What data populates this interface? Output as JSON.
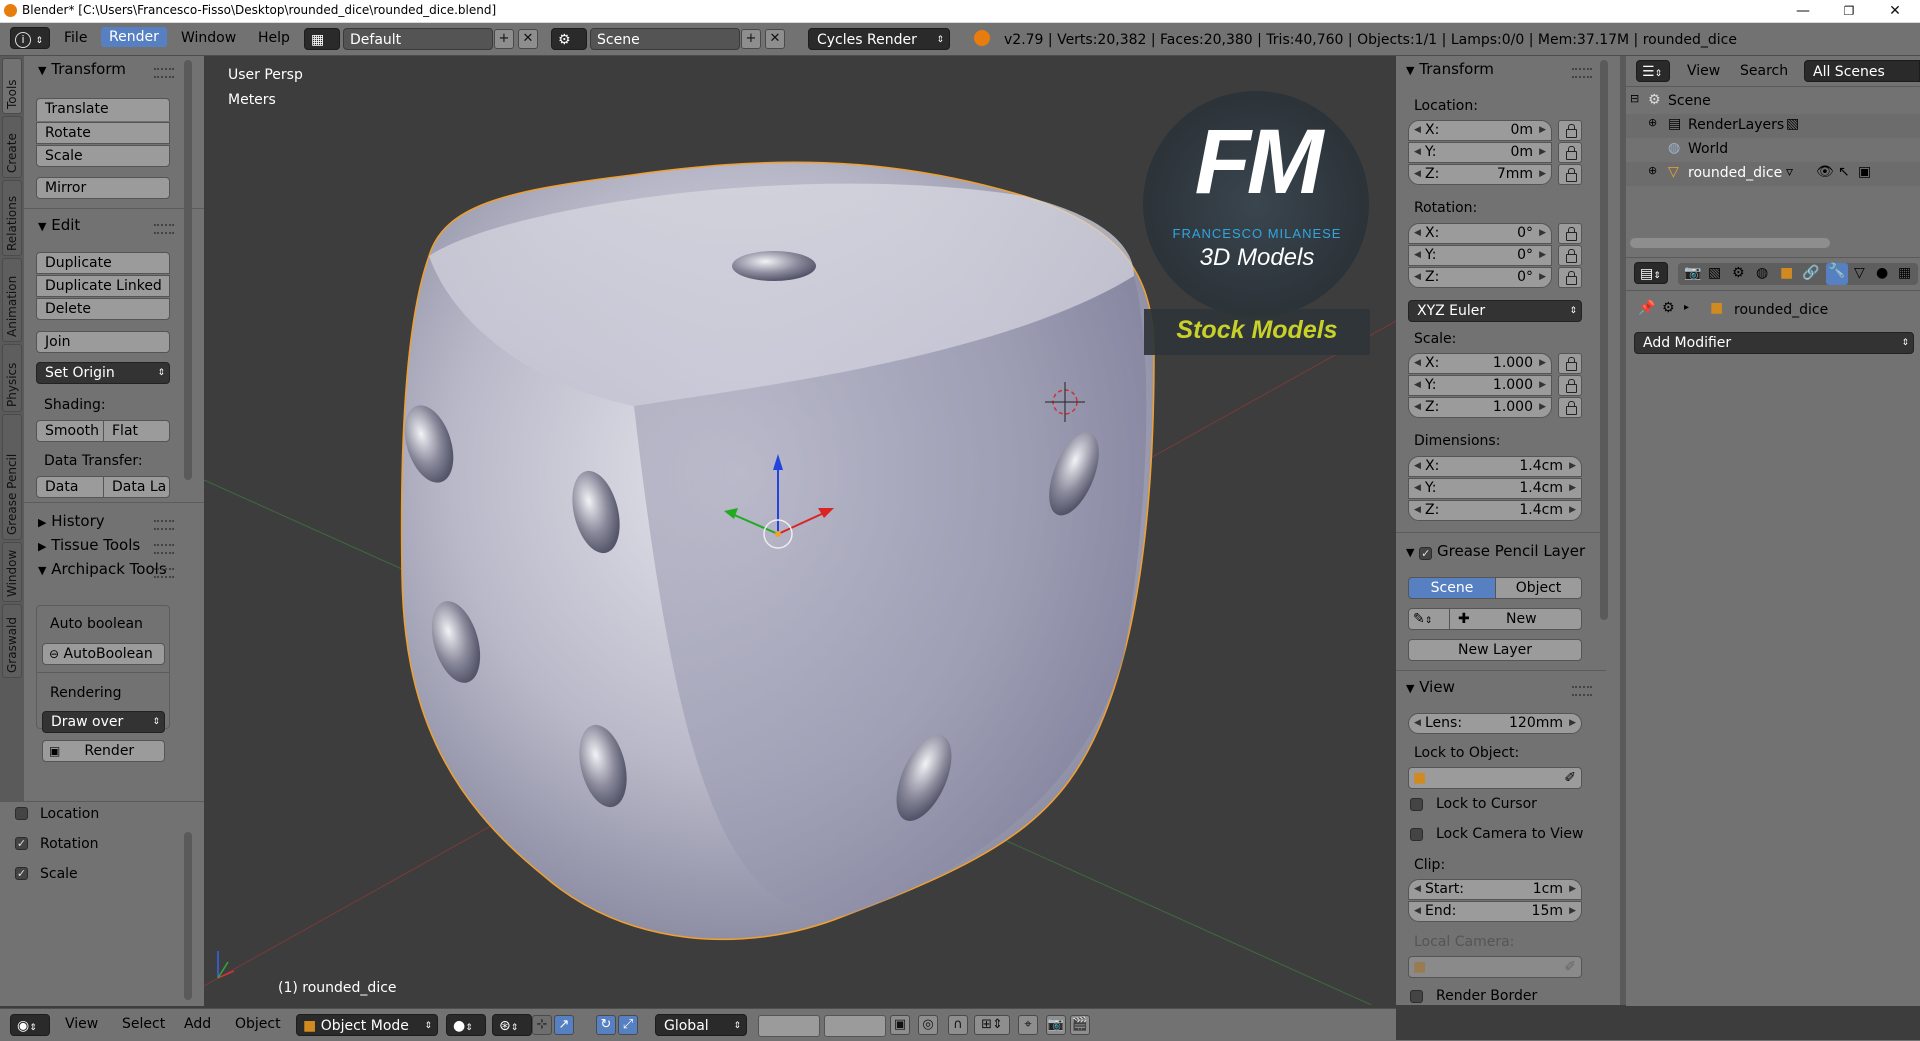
{
  "title_bar": {
    "title": "Blender* [C:\\Users\\Francesco-Fisso\\Desktop\\rounded_dice\\rounded_dice.blend]",
    "min": "—",
    "max": "❐",
    "close": "✕"
  },
  "info_header": {
    "menus": [
      "File",
      "Render",
      "Window",
      "Help"
    ],
    "active_menu": "Render",
    "layout": "Default",
    "scene": "Scene",
    "engine": "Cycles Render",
    "stats": "v2.79 | Verts:20,382 | Faces:20,380 | Tris:40,760 | Objects:1/1 | Lamps:0/0 | Mem:37.17M | rounded_dice"
  },
  "tool_tabs": [
    "Tools",
    "Create",
    "Relations",
    "Animation",
    "Physics",
    "Grease Pencil",
    "Window",
    "Graswald"
  ],
  "tools_panel": {
    "transform_title": "Transform",
    "translate": "Translate",
    "rotate": "Rotate",
    "scale": "Scale",
    "mirror": "Mirror",
    "edit_title": "Edit",
    "duplicate": "Duplicate",
    "duplicate_linked": "Duplicate Linked",
    "delete": "Delete",
    "join": "Join",
    "set_origin": "Set Origin",
    "shading_label": "Shading:",
    "smooth": "Smooth",
    "flat": "Flat",
    "data_transfer_label": "Data Transfer:",
    "data": "Data",
    "data_la": "Data La",
    "history": "History",
    "tissue_tools": "Tissue Tools",
    "archipack": "Archipack Tools",
    "auto_boolean_label": "Auto boolean",
    "autoboolean_btn": "AutoBoolean",
    "rendering_label": "Rendering",
    "draw_over": "Draw over",
    "render_btn": "Render"
  },
  "keying": {
    "location": "Location",
    "rotation": "Rotation",
    "scale": "Scale"
  },
  "viewport": {
    "view_name": "User Persp",
    "units": "Meters",
    "object_label": "(1) rounded_dice",
    "logo_letters": "FM",
    "logo_name": "FRANCESCO MILANESE",
    "logo_sub": "3D Models",
    "stock": "Stock Models"
  },
  "properties_n": {
    "transform_title": "Transform",
    "location_label": "Location:",
    "location": [
      {
        "axis": "X:",
        "value": "0m"
      },
      {
        "axis": "Y:",
        "value": "0m"
      },
      {
        "axis": "Z:",
        "value": "7mm"
      }
    ],
    "rotation_label": "Rotation:",
    "rotation": [
      {
        "axis": "X:",
        "value": "0°"
      },
      {
        "axis": "Y:",
        "value": "0°"
      },
      {
        "axis": "Z:",
        "value": "0°"
      }
    ],
    "rotation_mode": "XYZ Euler",
    "scale_label": "Scale:",
    "scale": [
      {
        "axis": "X:",
        "value": "1.000"
      },
      {
        "axis": "Y:",
        "value": "1.000"
      },
      {
        "axis": "Z:",
        "value": "1.000"
      }
    ],
    "dimensions_label": "Dimensions:",
    "dimensions": [
      {
        "axis": "X:",
        "value": "1.4cm"
      },
      {
        "axis": "Y:",
        "value": "1.4cm"
      },
      {
        "axis": "Z:",
        "value": "1.4cm"
      }
    ],
    "grease_pencil_title": "Grease Pencil Layer",
    "gp_scene": "Scene",
    "gp_object": "Object",
    "gp_new": "New",
    "gp_new_layer": "New Layer",
    "view_title": "View",
    "lens_label": "Lens:",
    "lens_value": "120mm",
    "lock_to_object": "Lock to Object:",
    "lock_to_cursor": "Lock to Cursor",
    "lock_camera": "Lock Camera to View",
    "clip_label": "Clip:",
    "clip_start_label": "Start:",
    "clip_start": "1cm",
    "clip_end_label": "End:",
    "clip_end": "15m",
    "local_camera": "Local Camera:",
    "render_border": "Render Border"
  },
  "outliner": {
    "view": "View",
    "search": "Search",
    "filter": "All Scenes",
    "items": [
      "Scene",
      "RenderLayers",
      "World",
      "rounded_dice"
    ]
  },
  "properties_editor": {
    "object_name": "rounded_dice",
    "add_modifier": "Add Modifier"
  },
  "bottom_header": {
    "menus": [
      "View",
      "Select",
      "Add",
      "Object"
    ],
    "mode": "Object Mode",
    "orientation": "Global"
  },
  "colors": {
    "accent": "#5680c2",
    "panel": "#727272",
    "viewport": "#3d3d3d",
    "selection_outline": "#f0a030",
    "logo_blue": "#2fa6e0",
    "stock_yellow": "#c8d02a"
  }
}
